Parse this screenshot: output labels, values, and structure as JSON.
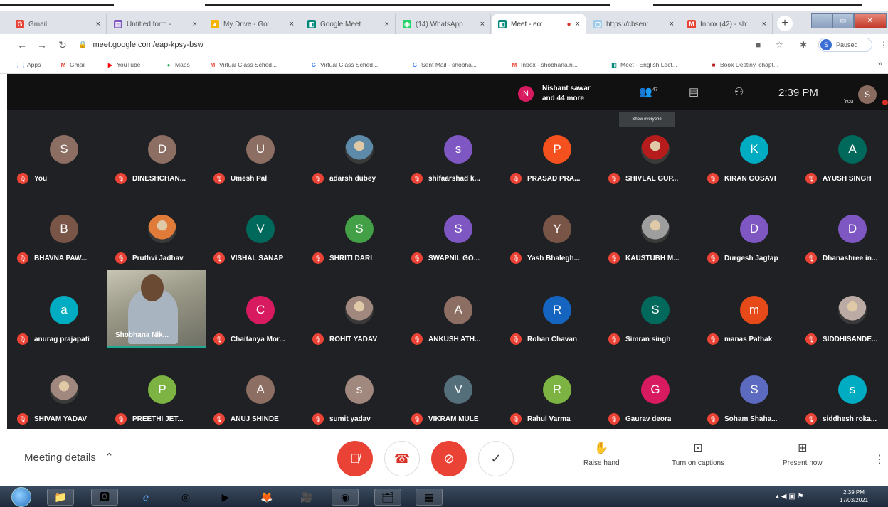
{
  "browser": {
    "tabs": [
      {
        "title": "Gmail",
        "icon": "G",
        "color": "#ea4335",
        "active": false
      },
      {
        "title": "Untitled form -",
        "icon": "▤",
        "color": "#7e57c2",
        "active": false
      },
      {
        "title": "My Drive - Go:",
        "icon": "▲",
        "color": "#f4b400",
        "active": false
      },
      {
        "title": "Google Meet",
        "icon": "◧",
        "color": "#00897b",
        "active": false
      },
      {
        "title": "(14) WhatsApp",
        "icon": "◉",
        "color": "#25d366",
        "active": false
      },
      {
        "title": "Meet - eo:",
        "icon": "◧",
        "color": "#00897b",
        "active": true
      },
      {
        "title": "https://cbsen:",
        "icon": "▢",
        "color": "#9ecbe8",
        "active": false
      },
      {
        "title": "Inbox (42) - sh:",
        "icon": "M",
        "color": "#ea4335",
        "active": false
      }
    ],
    "url": "meet.google.com/eap-kpsy-bsw",
    "profile_label": "Paused",
    "profile_initial": "S",
    "bookmarks": [
      {
        "label": "Apps",
        "icon": "⋮⋮",
        "color": "#4285f4"
      },
      {
        "label": "Gmail",
        "icon": "M",
        "color": "#ea4335"
      },
      {
        "label": "YouTube",
        "icon": "▶",
        "color": "#ff0000"
      },
      {
        "label": "Maps",
        "icon": "●",
        "color": "#34a853"
      },
      {
        "label": "Virtual Class Sched...",
        "icon": "M",
        "color": "#ea4335"
      },
      {
        "label": "Virtual Class Sched...",
        "icon": "G",
        "color": "#4285f4"
      },
      {
        "label": "Sent Mail - shobha...",
        "icon": "G",
        "color": "#4285f4"
      },
      {
        "label": "Inbox - shobhana.n...",
        "icon": "M",
        "color": "#ea4335"
      },
      {
        "label": "Meet - English Lect...",
        "icon": "◧",
        "color": "#00897b"
      },
      {
        "label": "Book Destiny, chapt...",
        "icon": "■",
        "color": "#b71c1c"
      }
    ]
  },
  "meet": {
    "notification": {
      "initial": "N",
      "text_line1": "Nishant sawar",
      "text_line2": "and 44 more"
    },
    "people_count": "47",
    "time": "2:39 PM",
    "you_label": "You",
    "self_initial": "S",
    "tooltip": "Show everyone",
    "participants": [
      {
        "name": "You",
        "initial": "S",
        "color": "#8d6e63"
      },
      {
        "name": "DINESHCHAN...",
        "initial": "D",
        "color": "#8d6e63"
      },
      {
        "name": "Umesh Pal",
        "initial": "U",
        "color": "#8d6e63"
      },
      {
        "name": "adarsh dubey",
        "initial": "",
        "color": "#5d8aa8",
        "photo": true
      },
      {
        "name": "shifaarshad k...",
        "initial": "s",
        "color": "#7e57c2"
      },
      {
        "name": "PRASAD PRA...",
        "initial": "P",
        "color": "#f4511e"
      },
      {
        "name": "SHIVLAL GUP...",
        "initial": "",
        "color": "#b71c1c",
        "photo": true
      },
      {
        "name": "KIRAN GOSAVI",
        "initial": "K",
        "color": "#00acc1"
      },
      {
        "name": "AYUSH SINGH",
        "initial": "A",
        "color": "#00695c"
      },
      {
        "name": "BHAVNA PAW...",
        "initial": "B",
        "color": "#795548"
      },
      {
        "name": "Pruthvi Jadhav",
        "initial": "",
        "color": "#e07b39",
        "photo": true
      },
      {
        "name": "VISHAL SANAP",
        "initial": "V",
        "color": "#00695c"
      },
      {
        "name": "SHRITI DARI",
        "initial": "S",
        "color": "#43a047"
      },
      {
        "name": "SWAPNIL GO...",
        "initial": "S",
        "color": "#7e57c2"
      },
      {
        "name": "Yash Bhalegh...",
        "initial": "Y",
        "color": "#795548"
      },
      {
        "name": "KAUSTUBH M...",
        "initial": "",
        "color": "#9e9e9e",
        "photo": true
      },
      {
        "name": "Durgesh Jagtap",
        "initial": "D",
        "color": "#7e57c2"
      },
      {
        "name": "Dhanashree in...",
        "initial": "D",
        "color": "#7e57c2"
      },
      {
        "name": "anurag prajapati",
        "initial": "a",
        "color": "#00acc1"
      },
      {
        "name": "Shobhana Nik...",
        "initial": "",
        "color": "#888",
        "video": true
      },
      {
        "name": "Chaitanya Mor...",
        "initial": "C",
        "color": "#d81b60"
      },
      {
        "name": "ROHIT YADAV",
        "initial": "",
        "color": "#a1887f",
        "photo": true
      },
      {
        "name": "ANKUSH ATH...",
        "initial": "A",
        "color": "#8d6e63"
      },
      {
        "name": "Rohan Chavan",
        "initial": "R",
        "color": "#1565c0"
      },
      {
        "name": "Simran singh",
        "initial": "S",
        "color": "#00695c"
      },
      {
        "name": "manas Pathak",
        "initial": "m",
        "color": "#e64a19"
      },
      {
        "name": "SIDDHISANDE...",
        "initial": "",
        "color": "#bcaaa4",
        "photo": true
      },
      {
        "name": "SHIVAM YADAV",
        "initial": "",
        "color": "#a1887f",
        "photo": true
      },
      {
        "name": "PREETHI JET...",
        "initial": "P",
        "color": "#7cb342"
      },
      {
        "name": "ANUJ SHINDE",
        "initial": "A",
        "color": "#8d6e63"
      },
      {
        "name": "sumit yadav",
        "initial": "s",
        "color": "#a1887f"
      },
      {
        "name": "VIKRAM MULE",
        "initial": "V",
        "color": "#546e7a"
      },
      {
        "name": "Rahul Varma",
        "initial": "R",
        "color": "#7cb342"
      },
      {
        "name": "Gaurav deora",
        "initial": "G",
        "color": "#d81b60"
      },
      {
        "name": "Soham Shaha...",
        "initial": "S",
        "color": "#5c6bc0"
      },
      {
        "name": "siddhesh roka...",
        "initial": "s",
        "color": "#00acc1"
      }
    ]
  },
  "controls": {
    "meeting_details": "Meeting details",
    "raise_hand": "Raise hand",
    "captions": "Turn on captions",
    "present": "Present now"
  },
  "taskbar": {
    "time": "2:39 PM",
    "date": "17/03/2021"
  }
}
